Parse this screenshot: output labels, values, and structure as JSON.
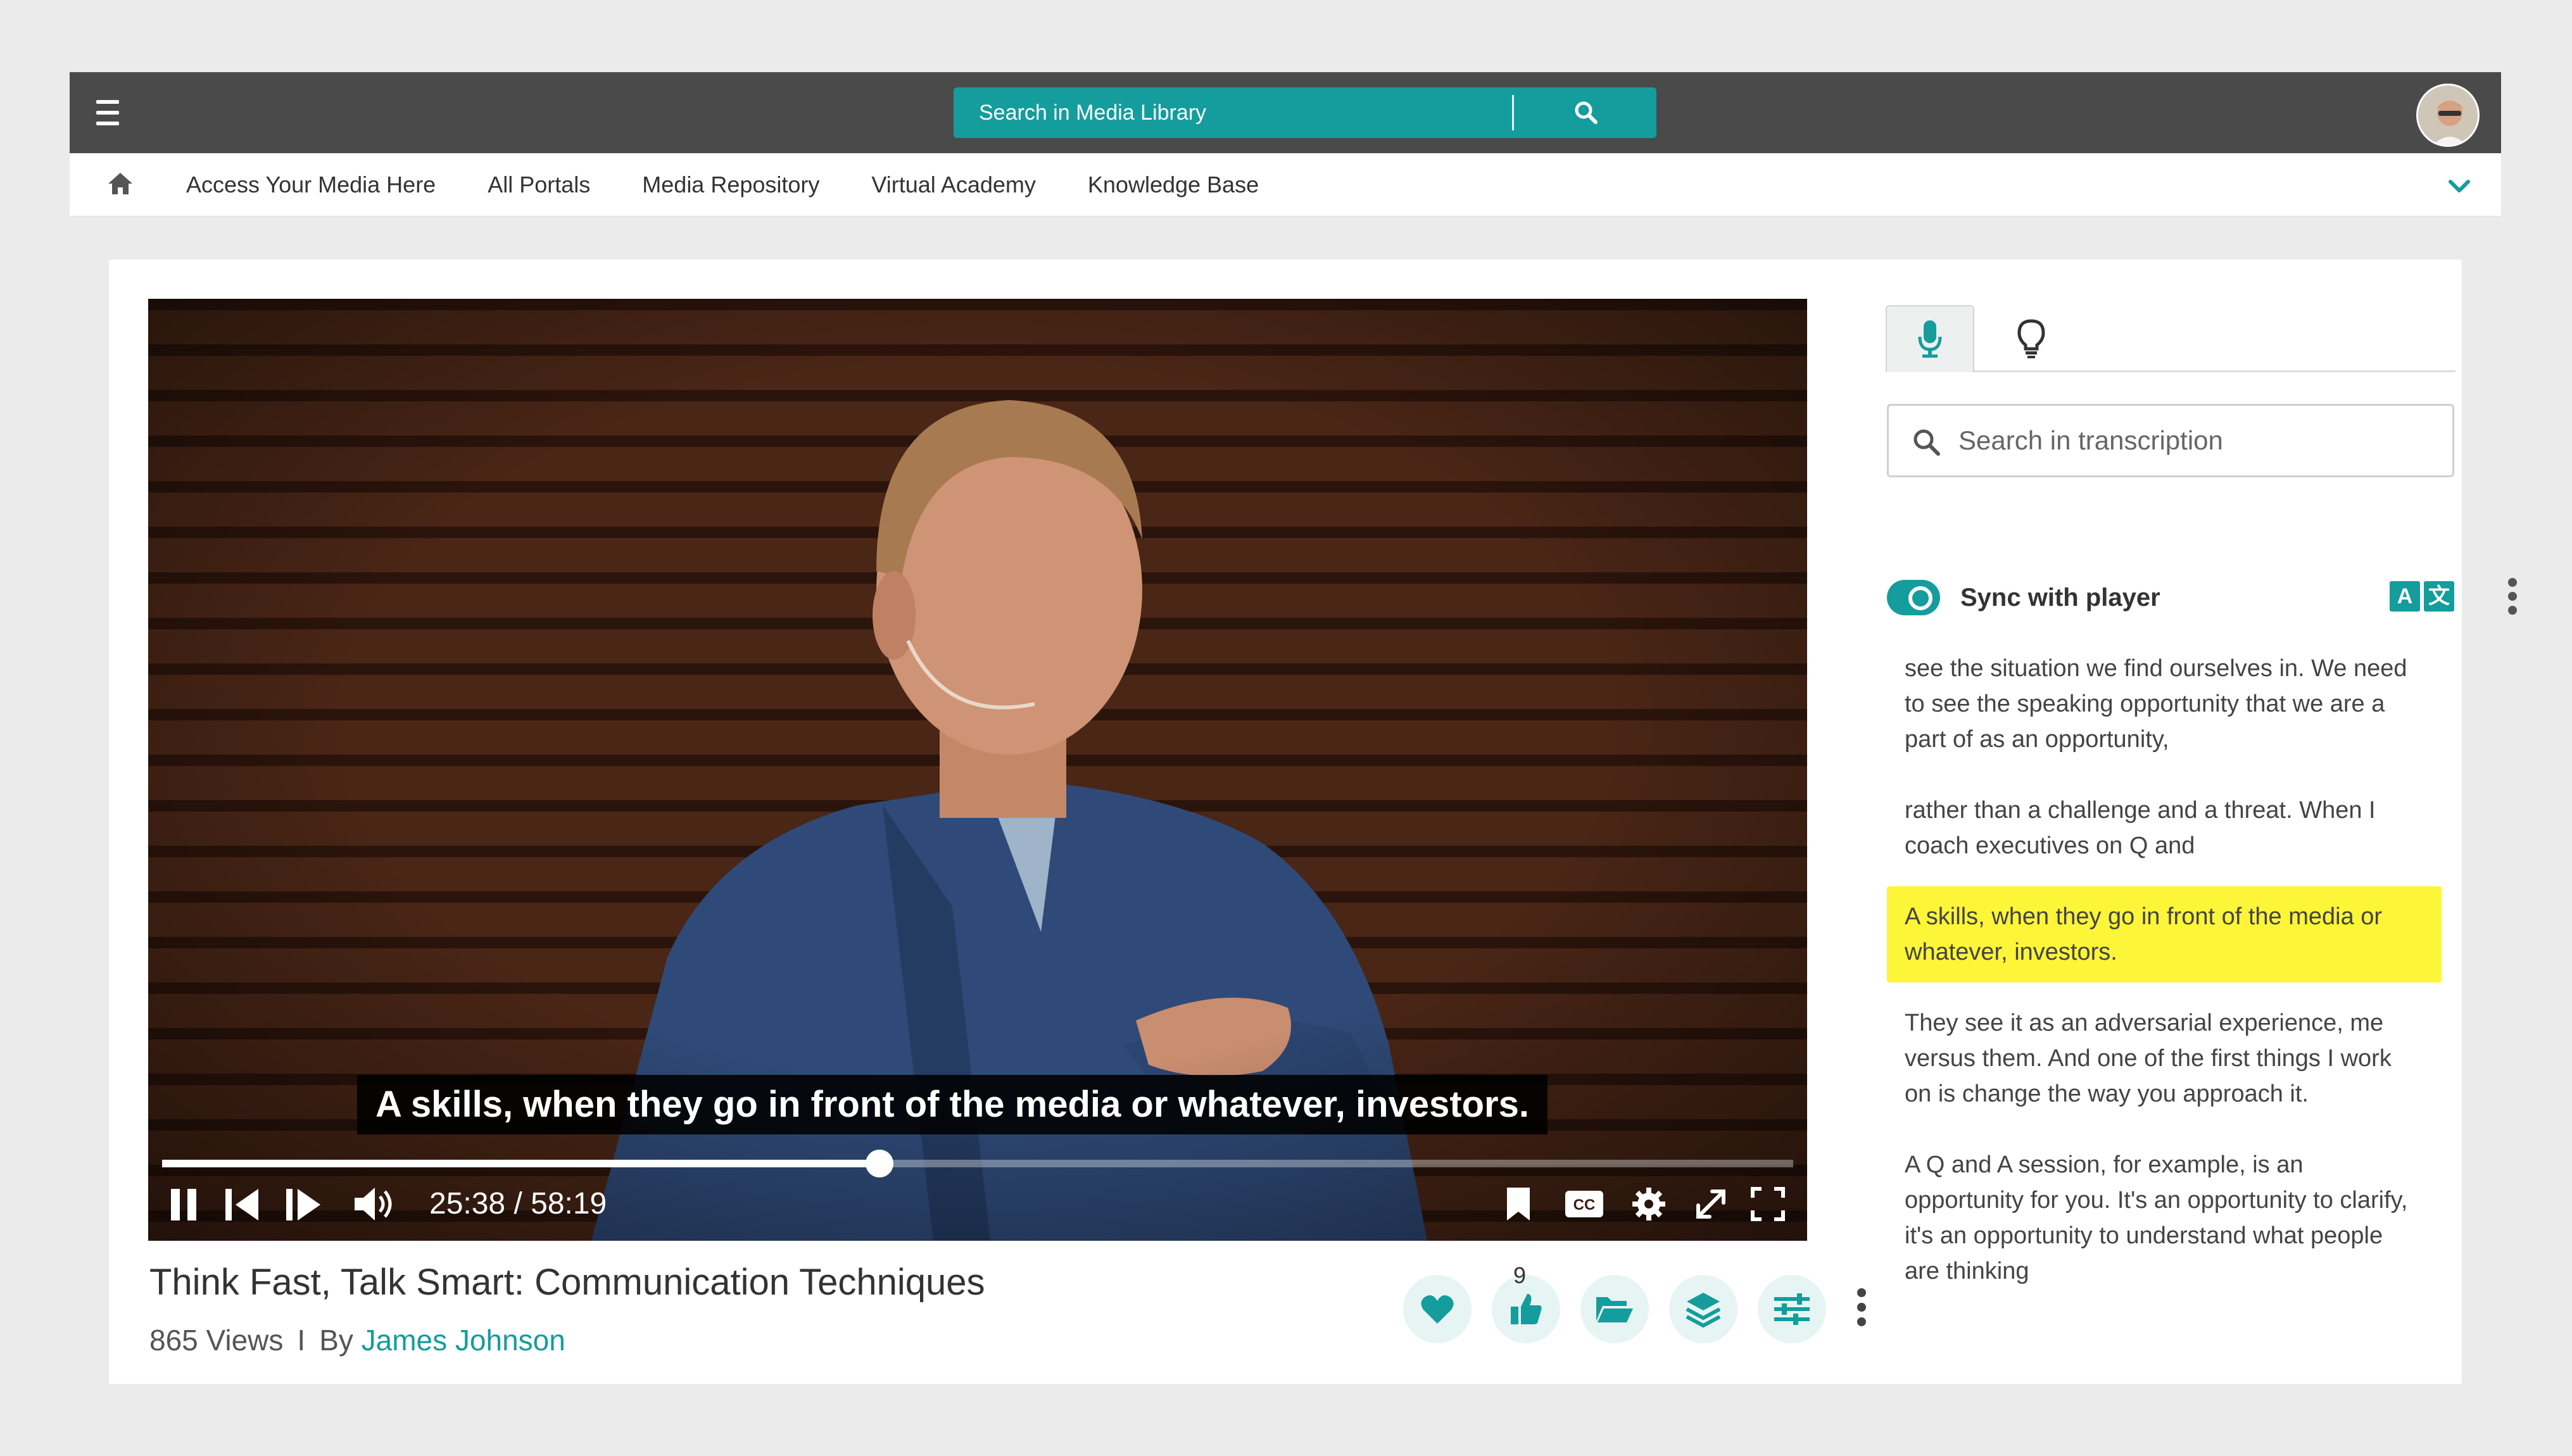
{
  "header": {
    "search_placeholder": "Search in Media Library"
  },
  "nav": {
    "links": [
      "Access Your Media Here",
      "All Portals",
      "Media Repository",
      "Virtual Academy",
      "Knowledge Base"
    ]
  },
  "player": {
    "caption": "A skills, when they go in front of the media or whatever, investors.",
    "time_display": "25:38 / 58:19",
    "progress_fraction": 0.44,
    "state": "playing"
  },
  "media": {
    "title": "Think Fast, Talk Smart: Communication Techniques",
    "views": "865 Views",
    "separator": "I",
    "by_label": "By",
    "author": "James Johnson",
    "like_count": "9"
  },
  "transcript": {
    "search_placeholder": "Search in transcription",
    "sync_label": "Sync with player",
    "sync_enabled": true,
    "lang_a": "A",
    "lang_b": "文",
    "segments": [
      "see the situation we find ourselves in. We need to see the speaking opportunity that we are a part of as an opportunity,",
      "rather than a challenge and a threat. When I coach executives on Q and",
      "A skills, when they go in front of the media or whatever, investors.",
      "They see it as an adversarial experience, me versus them. And one of the first things I work on is change the way you approach it.",
      "A Q and A session, for example, is an opportunity for you. It's an opportunity to clarify, it's an opportunity to understand what people are thinking"
    ],
    "active_segment": 2
  },
  "colors": {
    "accent": "#149d9c",
    "topbar": "#4a4a4a",
    "highlight": "#fcf538",
    "action_bg": "#e6f5f4"
  },
  "icons": {
    "menu": "hamburger-icon",
    "search": "search-icon",
    "home": "home-icon",
    "chevron": "chevron-down-icon",
    "mic": "microphone-icon",
    "bulb": "lightbulb-icon"
  }
}
